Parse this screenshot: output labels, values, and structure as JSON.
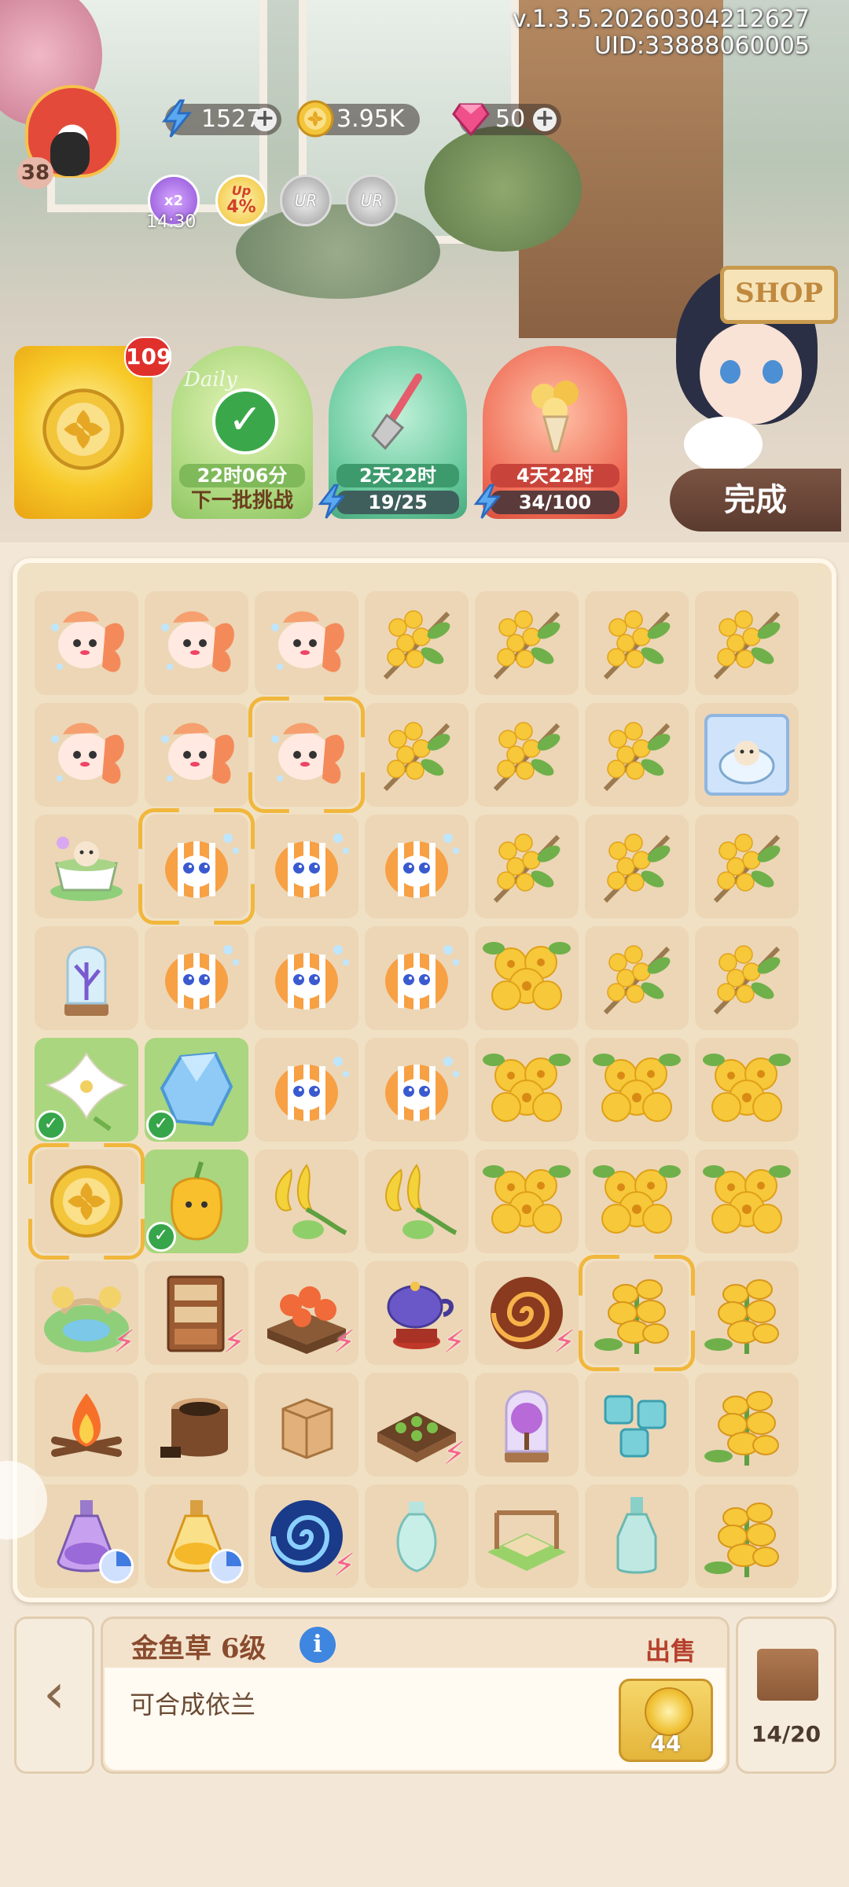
{
  "header": {
    "version": "v.1.3.5.20260304212627",
    "uid": "UID:33888060005",
    "player_level": "38",
    "energy": "1527",
    "coins": "3.95K",
    "gems": "50",
    "boost_timer": "14:30",
    "boost_multiplier": "x2",
    "up_percent": "4%",
    "up_label": "Up",
    "ur_label": "UR"
  },
  "events": {
    "coin_badge": "109",
    "daily_timer": "22时06分",
    "daily_label": "下一批挑战",
    "daily_script": "Daily",
    "shovel_timer": "2天22时",
    "shovel_progress": "19/25",
    "bouquet_timer": "4天22时",
    "bouquet_progress": "34/100"
  },
  "shop_sign": "SHOP",
  "done_button": "完成",
  "board": {
    "rows": [
      [
        "koi",
        "koi",
        "koi",
        "osmanthus",
        "osmanthus",
        "osmanthus",
        "osmanthus"
      ],
      [
        "koi",
        "koi",
        "koi",
        "osmanthus",
        "osmanthus",
        "osmanthus",
        "catcup-packet"
      ],
      [
        "catcup",
        "clownfish",
        "clownfish",
        "clownfish",
        "osmanthus",
        "osmanthus",
        "osmanthus"
      ],
      [
        "glass-dome",
        "clownfish",
        "clownfish",
        "clownfish",
        "yellow-flower",
        "osmanthus",
        "osmanthus"
      ],
      [
        "lily",
        "crystal",
        "clownfish",
        "clownfish",
        "yellow-flower",
        "yellow-flower",
        "yellow-flower"
      ],
      [
        "coin",
        "pepper",
        "ylang",
        "ylang",
        "yellow-flower",
        "yellow-flower",
        "yellow-flower"
      ],
      [
        "garden",
        "cabinet",
        "planter",
        "teapot",
        "vortex",
        "snapdragon",
        "snapdragon"
      ],
      [
        "campfire",
        "stump",
        "crate",
        "seedbed",
        "tree-dome",
        "puzzle",
        "snapdragon"
      ],
      [
        "potion-purple",
        "potion-yellow",
        "vortex-blue",
        "vase",
        "gazebo",
        "bottle",
        "snapdragon"
      ]
    ]
  },
  "selection": {
    "item_name": "金鱼草 6级",
    "sell_label": "出售",
    "description": "可合成依兰",
    "price": "44",
    "info_icon": "i"
  },
  "inventory": {
    "count": "14/20"
  },
  "colors": {
    "board_bg": "#f1e1c4",
    "cell_bg": "#ecd6b6",
    "ready_cell": "#a9d67f",
    "selection_border": "#f1b73c",
    "accent_red": "#e0302c"
  }
}
